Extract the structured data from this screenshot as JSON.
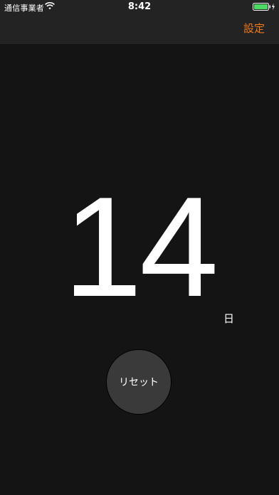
{
  "status_bar": {
    "carrier": "通信事業者",
    "time": "8:42",
    "wifi_icon": "wifi-icon",
    "battery_icon": "battery-charging-icon",
    "battery_color": "#4cd964"
  },
  "nav": {
    "settings_label": "設定",
    "accent_color": "#f07a1a"
  },
  "counter": {
    "value": "14",
    "unit": "日"
  },
  "reset": {
    "label": "リセット"
  }
}
